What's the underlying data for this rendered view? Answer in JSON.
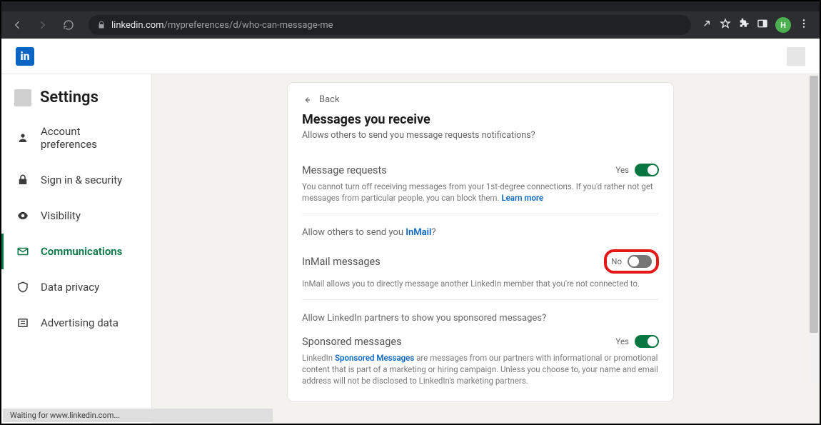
{
  "browser": {
    "url_host": "linkedin.com",
    "url_path": "/mypreferences/d/who-can-message-me",
    "profile_initial": "H"
  },
  "sidebar": {
    "title": "Settings",
    "items": [
      {
        "label": "Account preferences"
      },
      {
        "label": "Sign in & security"
      },
      {
        "label": "Visibility"
      },
      {
        "label": "Communications"
      },
      {
        "label": "Data privacy"
      },
      {
        "label": "Advertising data"
      }
    ]
  },
  "main": {
    "back_label": "Back",
    "title": "Messages you receive",
    "subtitle": "Allows others to send you message requests notifications?",
    "sections": {
      "message_requests": {
        "label": "Message requests",
        "state": "Yes",
        "on": true,
        "help": "You cannot turn off receiving messages from your 1st-degree connections. If you'd rather not get messages from particular people, you can block them. ",
        "help_link": "Learn more"
      },
      "inmail": {
        "prompt_prefix": "Allow others to send you ",
        "prompt_link": "InMail",
        "prompt_suffix": "?",
        "label": "InMail messages",
        "state": "No",
        "on": false,
        "help": "InMail allows you to directly message another LinkedIn member that you're not connected to."
      },
      "sponsored": {
        "prompt": "Allow LinkedIn partners to show you sponsored messages?",
        "label": "Sponsored messages",
        "state": "Yes",
        "on": true,
        "help_prefix": "LinkedIn ",
        "help_link": "Sponsored Messages",
        "help_suffix": " are messages from our partners with informational or promotional content that is part of a marketing or hiring campaign. Unless you choose to, your name and email address will not be disclosed to LinkedIn's marketing partners."
      }
    }
  },
  "status_bar": "Waiting for www.linkedin.com..."
}
